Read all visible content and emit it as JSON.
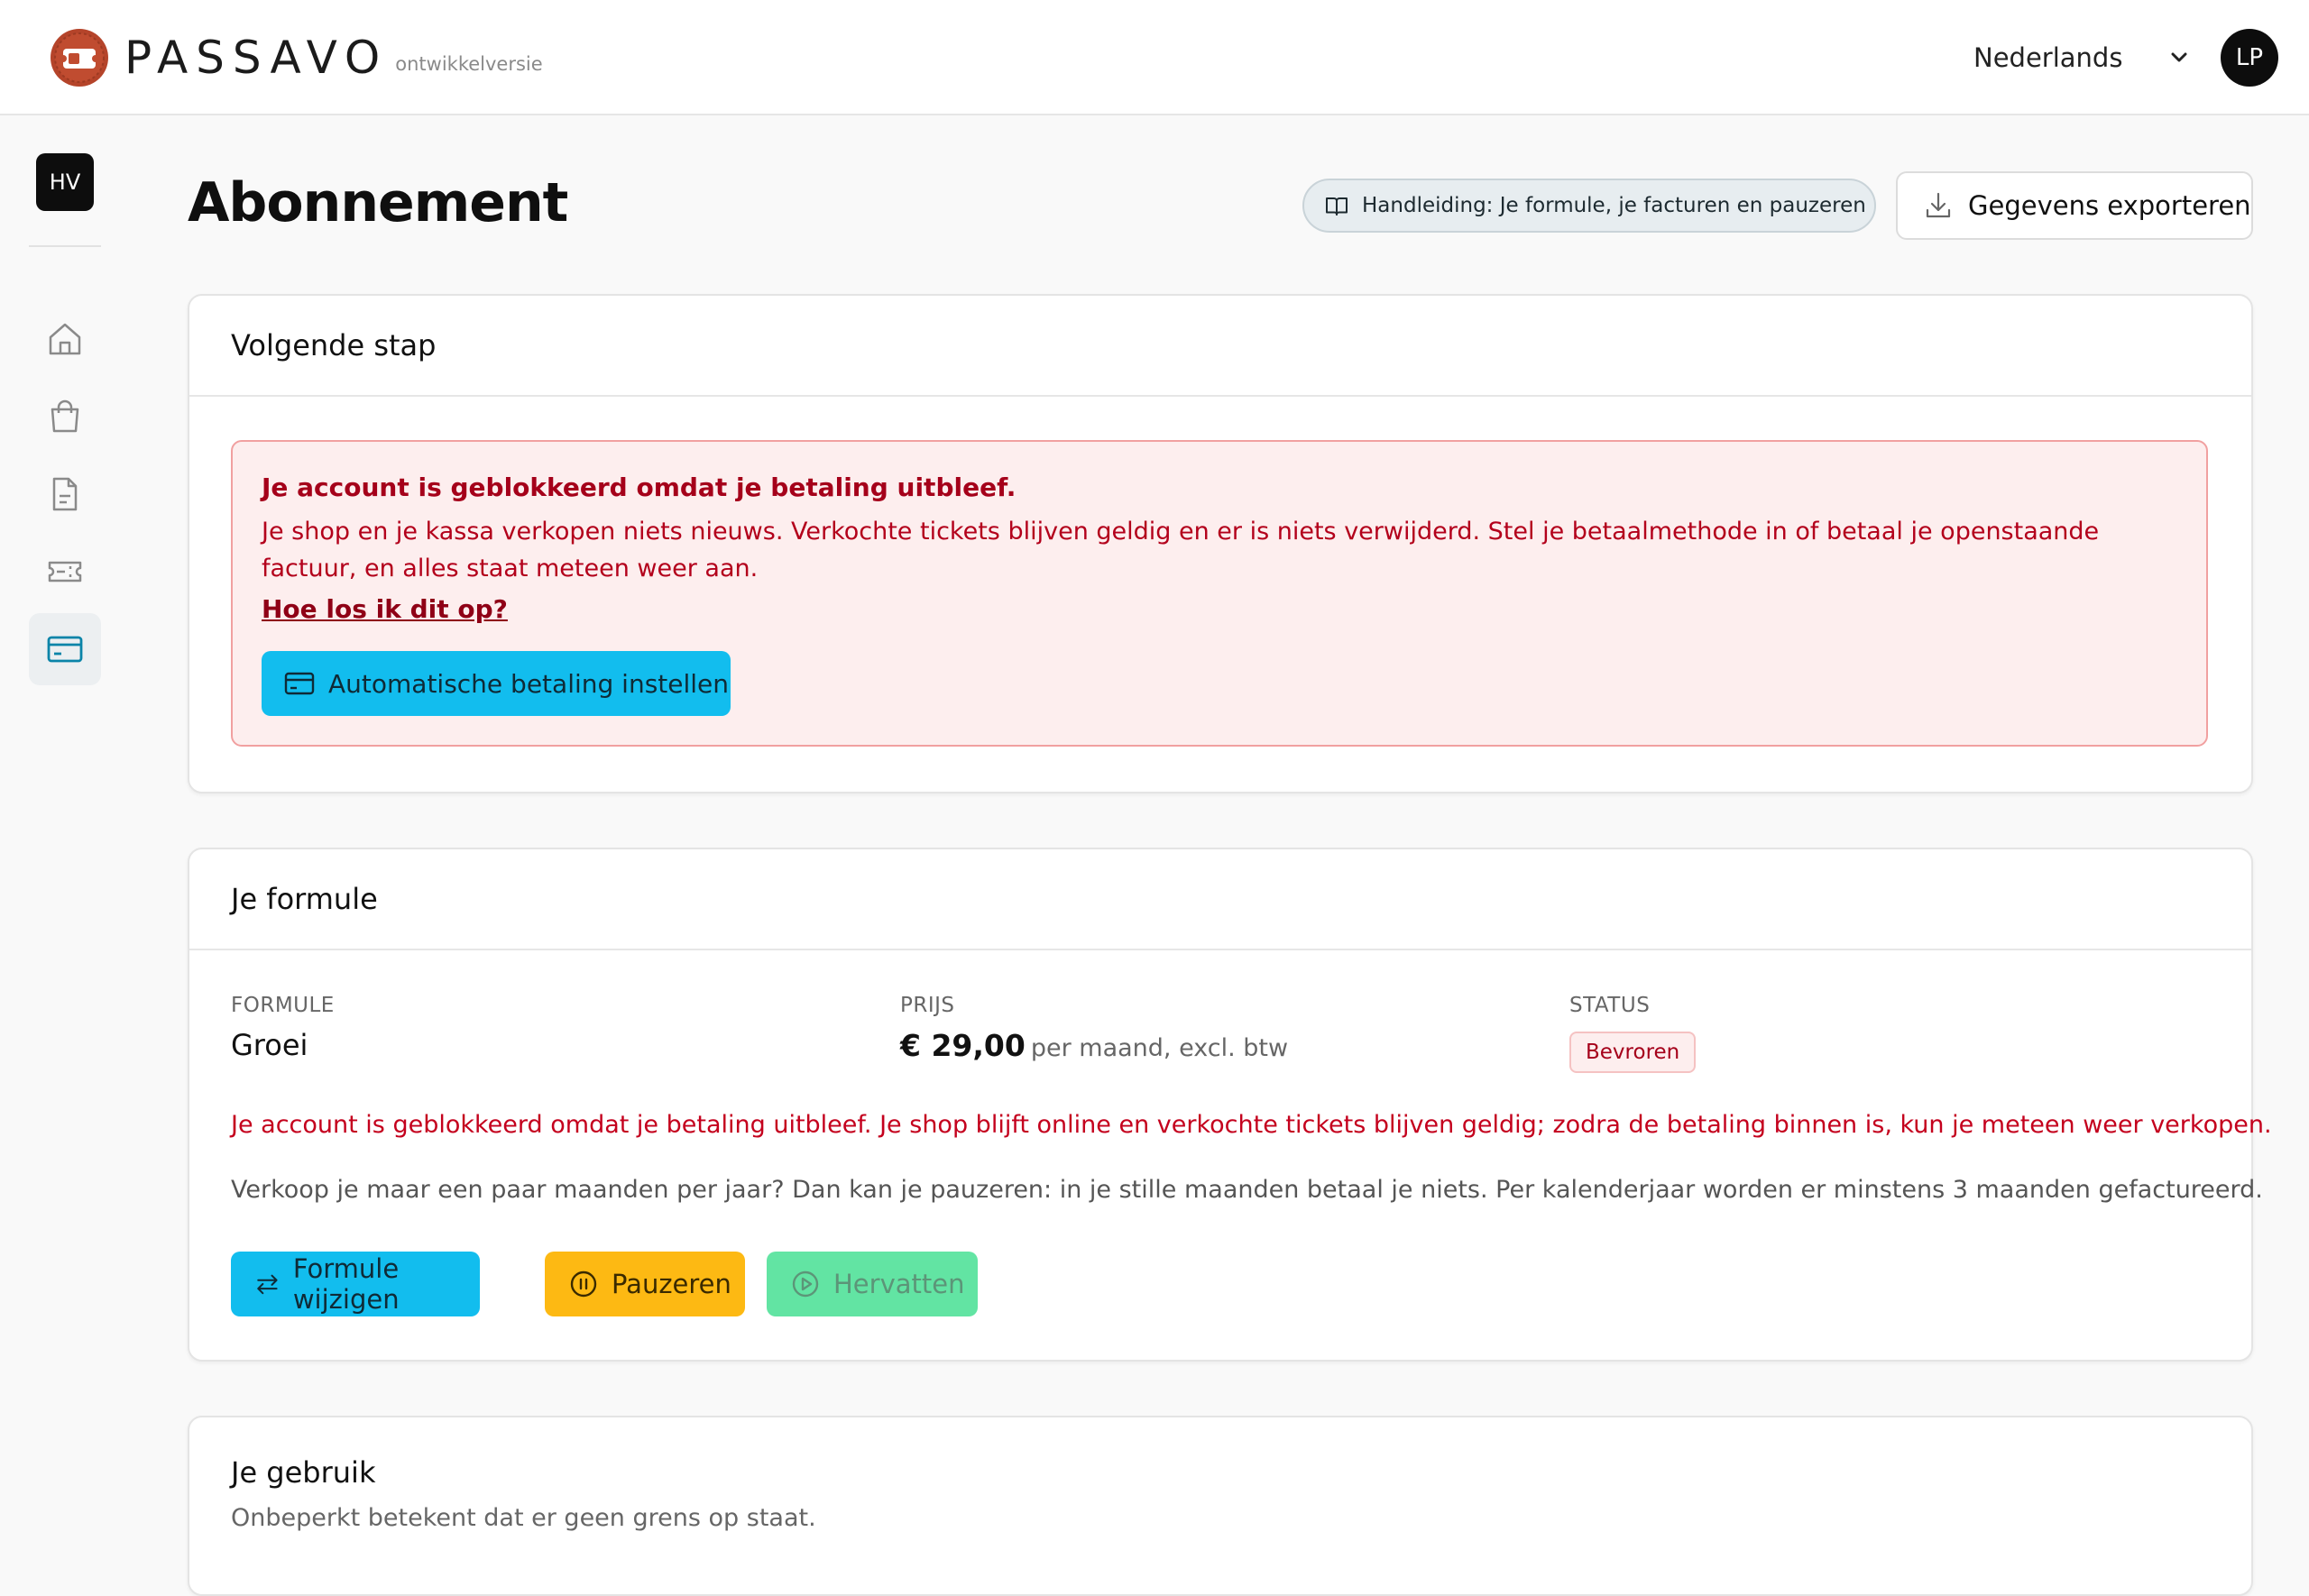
{
  "header": {
    "brand": "PASSAVO",
    "brand_sub": "ontwikkelversie",
    "language": "Nederlands",
    "user_initials": "LP"
  },
  "sidebar": {
    "workspace_initials": "HV",
    "items": [
      {
        "icon": "home-icon",
        "active": false
      },
      {
        "icon": "shopping-bag-icon",
        "active": false
      },
      {
        "icon": "document-icon",
        "active": false
      },
      {
        "icon": "ticket-icon",
        "active": false
      },
      {
        "icon": "credit-card-icon",
        "active": true
      }
    ]
  },
  "page": {
    "title": "Abonnement",
    "guide_button": "Handleiding: Je formule, je facturen en pauzeren",
    "export_button": "Gegevens exporteren"
  },
  "next_step": {
    "heading": "Volgende stap",
    "alert_title": "Je account is geblokkeerd omdat je betaling uitbleef.",
    "alert_text": "Je shop en je kassa verkopen niets nieuws. Verkochte tickets blijven geldig en er is niets verwijderd. Stel je betaalmethode in of betaal je openstaande factuur, en alles staat meteen weer aan.",
    "alert_link": "Hoe los ik dit op?",
    "pay_button": "Automatische betaling instellen"
  },
  "plan": {
    "heading": "Je formule",
    "formula_label": "FORMULE",
    "formula_value": "Groei",
    "price_label": "PRIJS",
    "price_value": "€ 29,00",
    "price_suffix": "per maand, excl. btw",
    "status_label": "STATUS",
    "status_value": "Bevroren",
    "warning": "Je account is geblokkeerd omdat je betaling uitbleef. Je shop blijft online en verkochte tickets blijven geldig; zodra de betaling binnen is, kun je meteen weer verkopen.",
    "info": "Verkoop je maar een paar maanden per jaar? Dan kan je pauzeren: in je stille maanden betaal je niets. Per kalenderjaar worden er minstens 3 maanden gefactureerd.",
    "change_button": "Formule wijzigen",
    "pause_button": "Pauzeren",
    "resume_button": "Hervatten"
  },
  "usage": {
    "heading": "Je gebruik",
    "subtitle": "Onbeperkt betekent dat er geen grens op staat."
  },
  "colors": {
    "primary": "#12bdee",
    "warning": "#fdb913",
    "success": "#52e29a",
    "danger": "#c4001d",
    "brand": "#b5442a"
  }
}
